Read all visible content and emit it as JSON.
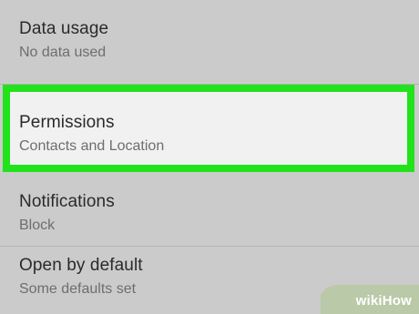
{
  "settings": {
    "items": [
      {
        "title": "Data usage",
        "subtitle": "No data used"
      },
      {
        "title": "Permissions",
        "subtitle": "Contacts and Location"
      },
      {
        "title": "Notifications",
        "subtitle": "Block"
      },
      {
        "title": "Open by default",
        "subtitle": "Some defaults set"
      }
    ],
    "highlighted_index": 1
  },
  "colors": {
    "background": "#cbcbcb",
    "highlight_border": "#22e21c",
    "highlight_fill": "#f1f1f1",
    "title_text": "#2a2a2a",
    "subtitle_text": "#6e6e6e"
  },
  "watermark": {
    "wiki": "wiki",
    "how": "How"
  }
}
